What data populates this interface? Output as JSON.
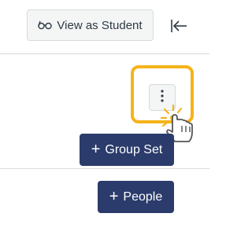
{
  "toolbar": {
    "view_as_student_label": "View as Student",
    "view_as_student_icon": "glasses-icon",
    "collapse_icon": "collapse-left-icon"
  },
  "options_menu": {
    "icon": "kebab-menu-icon",
    "highlight_color": "#f5b31b"
  },
  "actions": {
    "group_set_label": "Group Set",
    "people_label": "People",
    "add_icon": "+",
    "button_color": "#2b3b6b"
  }
}
